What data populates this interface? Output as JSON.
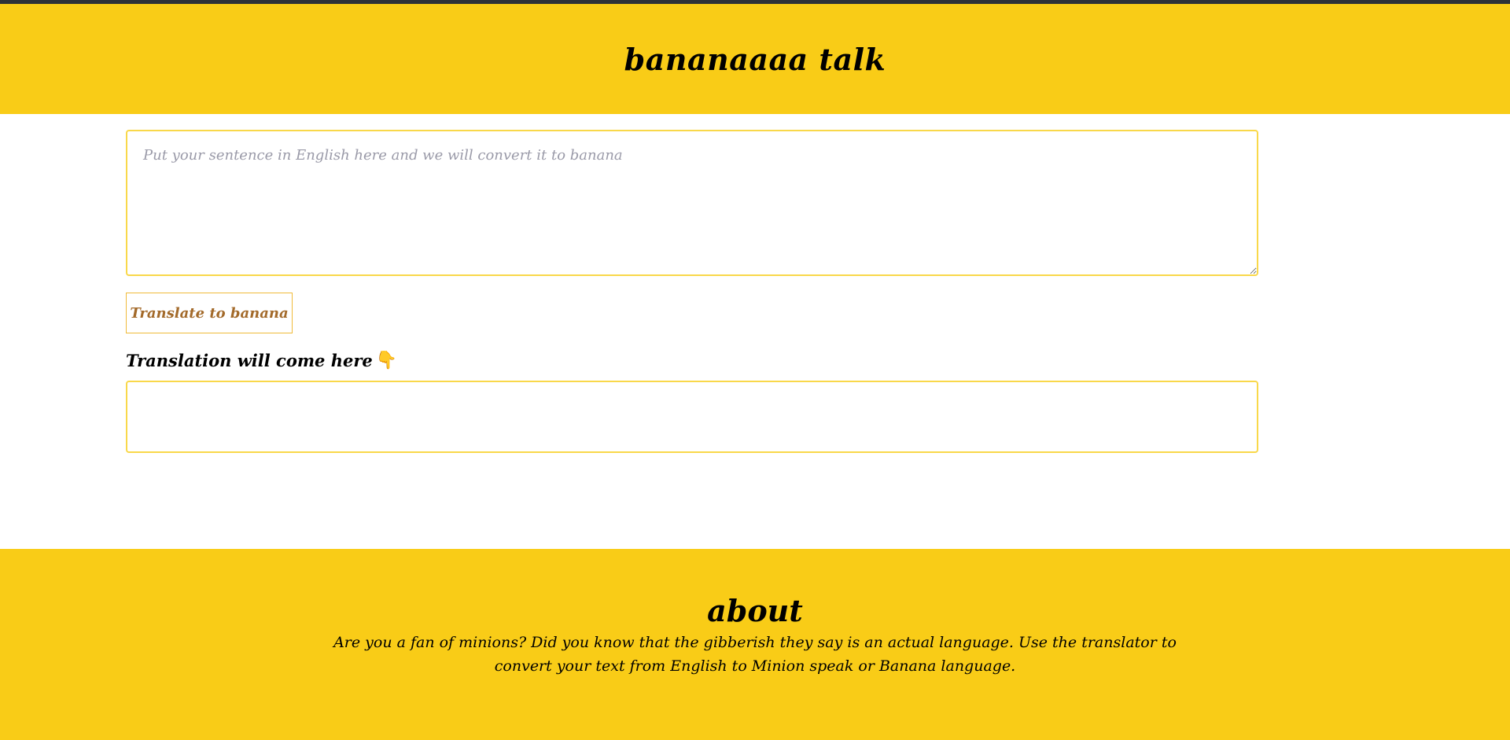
{
  "header": {
    "title": "bananaaaa talk"
  },
  "translator": {
    "input_placeholder": "Put your sentence in English here and we will convert it to banana",
    "input_value": "",
    "button_label": "Translate to banana",
    "output_label": "Translation will come here",
    "output_icon": "pointing-down-hand-icon",
    "output_value": ""
  },
  "footer": {
    "heading": "about",
    "description": "Are you a fan of minions? Did you know that the gibberish they say is an actual language. Use the translator to convert your text from English to Minion speak or Banana language."
  },
  "colors": {
    "accent_yellow": "#f9cc17",
    "topbar": "#2e3138",
    "button_text": "#a36a2a",
    "border": "#f9d84a"
  }
}
